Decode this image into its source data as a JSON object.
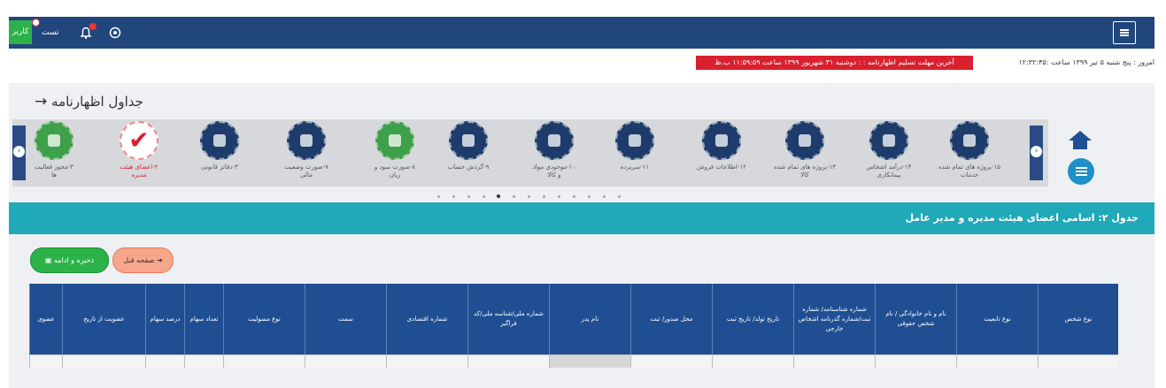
{
  "topbar": {
    "user_label": "کاربر",
    "logout_label": "تست",
    "bell_icon": "bell-icon",
    "settings_icon": "gear-icon",
    "menu_icon": "hamburger-icon",
    "bar_color": "#21467b"
  },
  "status": {
    "today": "امروز : پنج شنبه ۵ تیر ۱۳۹۹ ساعت :۱۲:۳۲:۴۵",
    "deadline": "آخرین مهلت تسلیم اظهارنامه : : دوشنبه ۳۱ شهریور ۱۳۹۹ ساعت ۱۱:۵۹:۵۹ ب.ظ"
  },
  "page": {
    "title": "جداول اظهارنامه",
    "back_icon": "arrow-right-icon"
  },
  "carousel": {
    "items": [
      {
        "label": "۱۵-پروژه های تمام شده",
        "sub": "خدمات",
        "style": "dark"
      },
      {
        "label": "۱۴-درآمد اشخاص",
        "sub": "پیمانکاری",
        "style": "dark"
      },
      {
        "label": "۱۳-پروژه های تمام شده",
        "sub": "کالا",
        "style": "dark"
      },
      {
        "label": "۱۲-اطلاعات فروش",
        "sub": "",
        "style": "dark"
      },
      {
        "label": "۱۱-سربرده",
        "sub": "",
        "style": "dark"
      },
      {
        "label": "۱۰-موجودی مواد",
        "sub": "و کالا",
        "style": "dark"
      },
      {
        "label": "۹-گردش حساب",
        "sub": "",
        "style": "dark"
      },
      {
        "label": "۸-صورت سود و",
        "sub": "زیان",
        "style": "green"
      },
      {
        "label": "۷-صورت وضعیت",
        "sub": "مالی",
        "style": "dark"
      },
      {
        "label": "۳-دفاتر قانونی",
        "sub": "",
        "style": "dark"
      },
      {
        "label": "۲-اعضای هیئت",
        "sub": "مدیره",
        "style": "white"
      },
      {
        "label": "۳-مجوز فعالیت",
        "sub": "ها",
        "style": "green"
      }
    ],
    "prev_icon": "chevron-left-icon",
    "next_icon": "chevron-right-icon"
  },
  "side": {
    "home_icon": "home-icon",
    "list_icon": "list-icon"
  },
  "section": {
    "title": "جدول ۲: اسامی اعضای هیئت مدیره و مدیر عامل"
  },
  "buttons": {
    "prev_page": "صفحه قبل",
    "save_continue": "ذخیره و ادامه"
  },
  "table": {
    "headers": [
      "نوع شخص",
      "نوع تابعیت",
      "نام و نام خانوادگی / نام شخص حقوقی",
      "شماره شناسنامه/ شماره ثبت/شماره گذرنامه اشخاص خارجی",
      "تاریخ تولد/ تاریخ ثبت",
      "محل صدور/ ثبت",
      "نام پدر",
      "شماره ملی/شناسه ملی/کد فراگیر",
      "شماره اقتصادی",
      "سمت",
      "نوع مسولیت",
      "تعداد سهام",
      "درصد سهام",
      "عضویت از تاریخ",
      "عضوی"
    ]
  }
}
